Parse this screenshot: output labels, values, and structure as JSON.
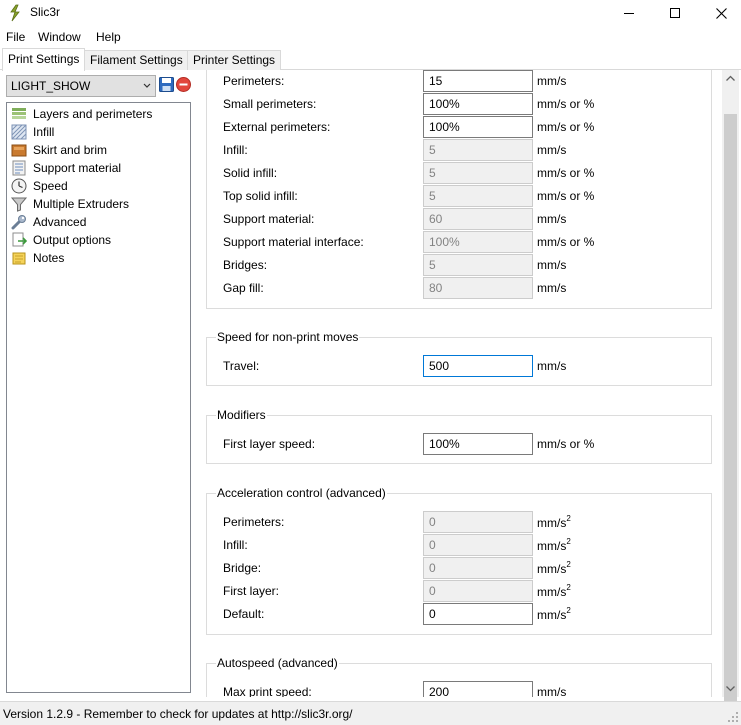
{
  "window": {
    "title": "Slic3r"
  },
  "menu": {
    "items": [
      "File",
      "Window",
      "Help"
    ]
  },
  "tabs": [
    {
      "label": "Print Settings",
      "active": true
    },
    {
      "label": "Filament Settings",
      "active": false
    },
    {
      "label": "Printer Settings",
      "active": false
    }
  ],
  "preset": {
    "selected": "LIGHT_SHOW"
  },
  "nav": {
    "items": [
      {
        "label": "Layers and perimeters",
        "icon": "layers-icon"
      },
      {
        "label": "Infill",
        "icon": "infill-icon"
      },
      {
        "label": "Skirt and brim",
        "icon": "skirt-brim-icon"
      },
      {
        "label": "Support material",
        "icon": "support-material-icon"
      },
      {
        "label": "Speed",
        "icon": "speed-icon"
      },
      {
        "label": "Multiple Extruders",
        "icon": "funnel-icon"
      },
      {
        "label": "Advanced",
        "icon": "wrench-icon"
      },
      {
        "label": "Output options",
        "icon": "output-icon"
      },
      {
        "label": "Notes",
        "icon": "note-icon"
      }
    ]
  },
  "speed_print": {
    "rows": [
      {
        "label": "Perimeters:",
        "value": "15",
        "unit": "mm/s",
        "enabled": true
      },
      {
        "label": "Small perimeters:",
        "value": "100%",
        "unit": "mm/s or %",
        "enabled": true
      },
      {
        "label": "External perimeters:",
        "value": "100%",
        "unit": "mm/s or %",
        "enabled": true
      },
      {
        "label": "Infill:",
        "value": "5",
        "unit": "mm/s",
        "enabled": false
      },
      {
        "label": "Solid infill:",
        "value": "5",
        "unit": "mm/s or %",
        "enabled": false
      },
      {
        "label": "Top solid infill:",
        "value": "5",
        "unit": "mm/s or %",
        "enabled": false
      },
      {
        "label": "Support material:",
        "value": "60",
        "unit": "mm/s",
        "enabled": false
      },
      {
        "label": "Support material interface:",
        "value": "100%",
        "unit": "mm/s or %",
        "enabled": false
      },
      {
        "label": "Bridges:",
        "value": "5",
        "unit": "mm/s",
        "enabled": false
      },
      {
        "label": "Gap fill:",
        "value": "80",
        "unit": "mm/s",
        "enabled": false
      }
    ]
  },
  "non_print": {
    "title": "Speed for non-print moves",
    "rows": [
      {
        "label": "Travel:",
        "value": "500",
        "unit": "mm/s",
        "enabled": true
      }
    ]
  },
  "modifiers": {
    "title": "Modifiers",
    "rows": [
      {
        "label": "First layer speed:",
        "value": "100%",
        "unit": "mm/s or %",
        "enabled": true
      }
    ]
  },
  "acceleration": {
    "title": "Acceleration control (advanced)",
    "unit_base": "mm/s",
    "unit_exp": "2",
    "rows": [
      {
        "label": "Perimeters:",
        "value": "0",
        "enabled": false
      },
      {
        "label": "Infill:",
        "value": "0",
        "enabled": false
      },
      {
        "label": "Bridge:",
        "value": "0",
        "enabled": false
      },
      {
        "label": "First layer:",
        "value": "0",
        "enabled": false
      },
      {
        "label": "Default:",
        "value": "0",
        "enabled": true
      }
    ]
  },
  "autospeed": {
    "title": "Autospeed (advanced)",
    "rows": [
      {
        "label": "Max print speed:",
        "value": "200",
        "unit": "mm/s",
        "enabled": true
      }
    ]
  },
  "status": {
    "text": "Version 1.2.9 - Remember to check for updates at http://slic3r.org/"
  },
  "colors": {
    "accent": "#0078d7",
    "disabled_bg": "#f0f0f0",
    "disabled_text": "#838383"
  }
}
